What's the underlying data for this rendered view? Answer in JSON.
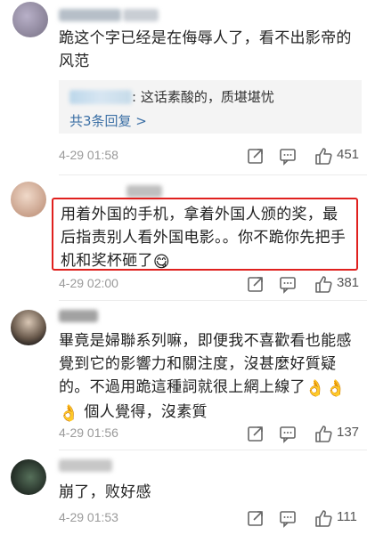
{
  "comments": [
    {
      "text": "跪这个字已经是在侮辱人了，看不出影帝的风范",
      "reply_preview": {
        "text": ": 这话素酸的，质堪堪忧",
        "more_label": "共3条回复 >"
      },
      "timestamp": "4-29 01:58",
      "likes": "451"
    },
    {
      "text": "用着外国的手机，拿着外国人颁的奖，最后指责别人看外国电影。。你不跪你先把手机和奖杯砸了",
      "emoji": "😋",
      "timestamp": "4-29 02:00",
      "likes": "381"
    },
    {
      "text_line1": "畢竟是婦聯系列嘛，即便我不喜歡看也能感覺到它的影響力和關注度，沒甚麼好質疑的。不過用跪這種詞就很上網上線了",
      "emoji_pair": "👌👌",
      "text_line2_emoji": "👌",
      "text_line2": " 個人覺得，沒素質",
      "timestamp": "4-29 01:56",
      "likes": "137"
    },
    {
      "text": "崩了，败好感",
      "timestamp": "4-29 01:53",
      "likes": "111"
    }
  ],
  "colors": {
    "highlight_border": "#e0201e",
    "reply_link": "#3b6fa5",
    "meta_text": "#9a9a9a"
  },
  "icons": {
    "share": "share-icon",
    "comment": "comment-icon",
    "like": "thumbs-up-icon"
  }
}
